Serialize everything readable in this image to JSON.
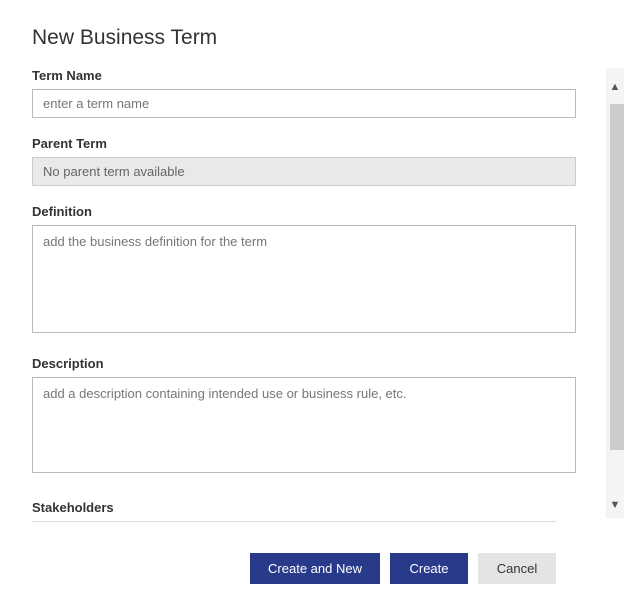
{
  "dialog": {
    "title": "New Business Term",
    "fields": {
      "term_name": {
        "label": "Term Name",
        "placeholder": "enter a term name",
        "value": ""
      },
      "parent_term": {
        "label": "Parent Term",
        "value": "No parent term available",
        "disabled": true
      },
      "definition": {
        "label": "Definition",
        "placeholder": "add the business definition for the term",
        "value": ""
      },
      "description": {
        "label": "Description",
        "placeholder": "add a description containing intended use or business rule, etc.",
        "value": ""
      },
      "stakeholders": {
        "label": "Stakeholders"
      }
    },
    "buttons": {
      "create_and_new": "Create and New",
      "create": "Create",
      "cancel": "Cancel"
    }
  }
}
